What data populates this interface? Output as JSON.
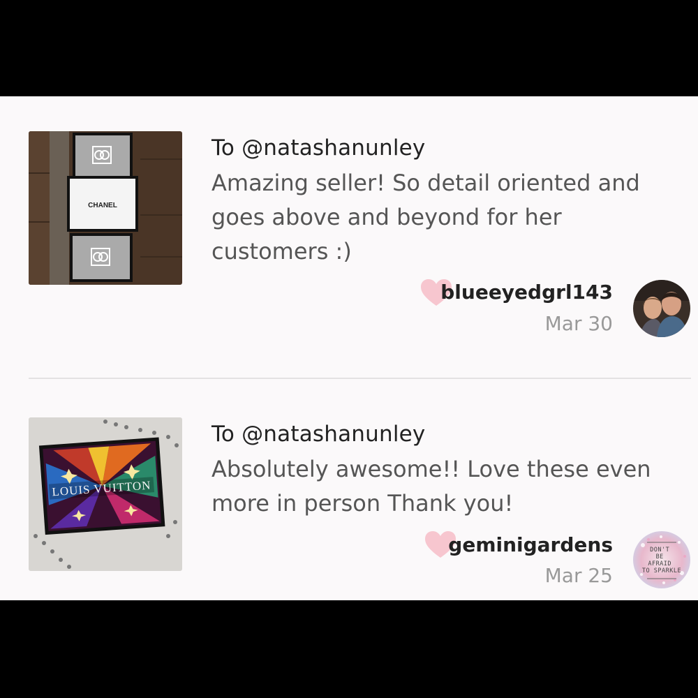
{
  "reviews": [
    {
      "to": "To @natashanunley",
      "text": "Amazing seller! So detail oriented and goes above and beyond for her customers :)",
      "username": "blueeyedgrl143",
      "date": "Mar 30",
      "thumbnail_icon": "chanel-frames-photo",
      "thumb_label": "CHANEL",
      "avatar_icon": "couple-photo-avatar"
    },
    {
      "to": "To @natashanunley",
      "text": "Absolutely awesome!! Love these even more in person Thank you!",
      "username": "geminigardens",
      "date": "Mar 25",
      "thumbnail_icon": "louis-vuitton-print-photo",
      "thumb_label": "LOUIS VUITTON",
      "avatar_icon": "dont-be-afraid-to-sparkle-avatar",
      "avatar_text": "DON'T BE AFRAID TO SPARKLE"
    }
  ],
  "colors": {
    "heart": "#f7c6cf",
    "background": "#fbf9fa",
    "divider": "#e3e1e2"
  }
}
